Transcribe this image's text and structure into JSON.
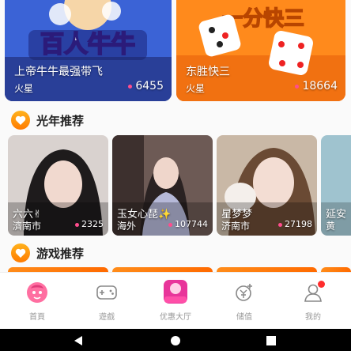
{
  "games": [
    {
      "banner_text": "百人牛牛",
      "name": "上帝牛牛最强带飞",
      "sub": "火星",
      "count": "6455"
    },
    {
      "banner_text": "一分快三",
      "name": "东胜快三",
      "sub": "火星",
      "count": "18664"
    }
  ],
  "sections": {
    "recommend_title": "光年推荐",
    "games_title": "游戏推荐"
  },
  "streamers": [
    {
      "name": "六六✌",
      "city": "濟南市",
      "count": "2325"
    },
    {
      "name": "玉女心琵✨",
      "city": "海外",
      "count": "107744"
    },
    {
      "name": "星梦梦",
      "city": "济南市",
      "count": "27198"
    },
    {
      "name": "延安",
      "city": "黄",
      "count": ""
    }
  ],
  "tabbar": {
    "items": [
      {
        "label": "首頁",
        "icon": "home-mascot-icon"
      },
      {
        "label": "遊戲",
        "icon": "gamepad-icon"
      },
      {
        "label": "优惠大厅",
        "icon": "promo-hall-icon",
        "badge_text": "优惠大厅"
      },
      {
        "label": "储值",
        "icon": "coin-plus-icon"
      },
      {
        "label": "我的",
        "icon": "user-icon"
      }
    ]
  },
  "colors": {
    "accent_orange": "#ff7a12",
    "pink_dot": "#ff4d8d",
    "badge_red": "#ff2d2d"
  }
}
